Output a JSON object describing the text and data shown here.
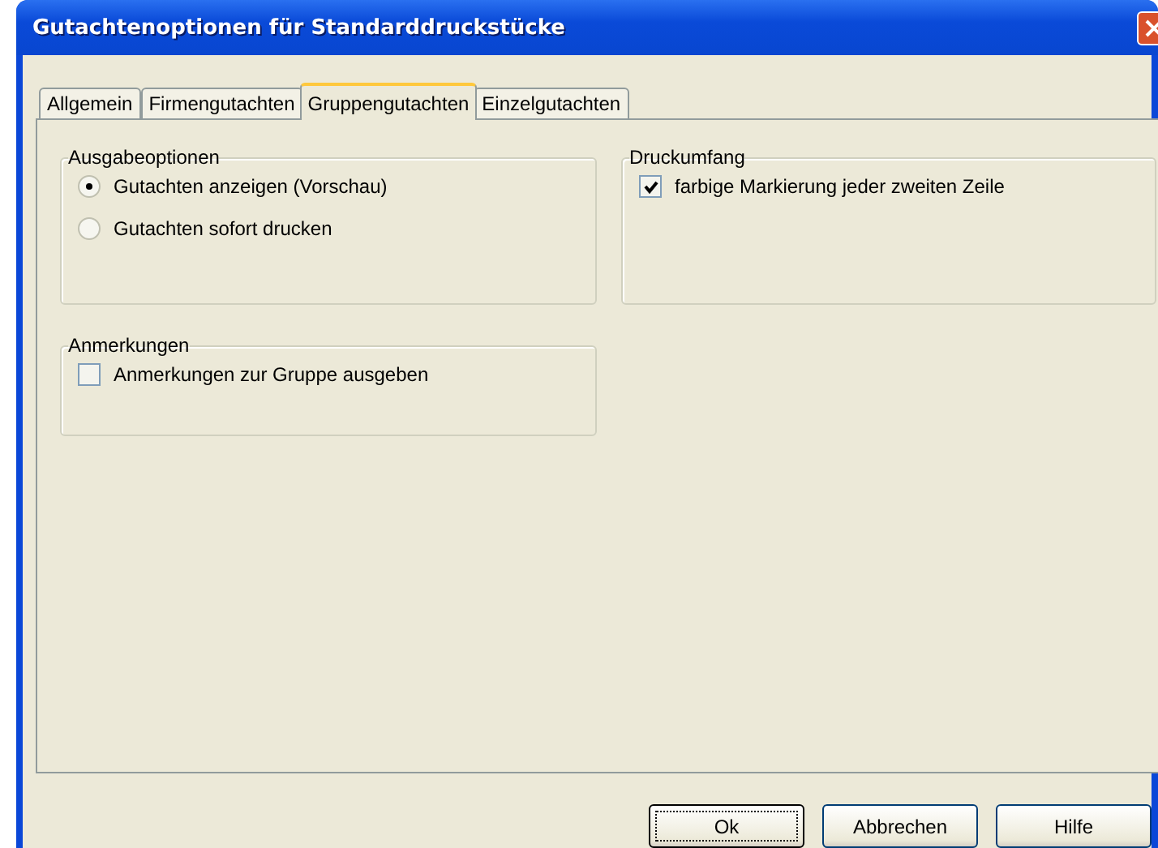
{
  "window": {
    "title": "Gutachtenoptionen für Standarddruckstücke"
  },
  "tabs": [
    {
      "label": "Allgemein",
      "selected": false
    },
    {
      "label": "Firmengutachten",
      "selected": false
    },
    {
      "label": "Gruppengutachten",
      "selected": true
    },
    {
      "label": "Einzelgutachten",
      "selected": false
    }
  ],
  "ausgabeoptionen": {
    "title": "Ausgabeoptionen",
    "options": [
      {
        "label": "Gutachten anzeigen (Vorschau)",
        "selected": true
      },
      {
        "label": "Gutachten sofort drucken",
        "selected": false
      }
    ]
  },
  "anmerkungen": {
    "title": "Anmerkungen",
    "checkbox": {
      "label": "Anmerkungen zur Gruppe ausgeben",
      "checked": false
    }
  },
  "druckumfang": {
    "title": "Druckumfang",
    "checkbox": {
      "label": "farbige Markierung jeder zweiten Zeile",
      "checked": true
    }
  },
  "buttons": [
    {
      "label": "Ok",
      "default": true
    },
    {
      "label": "Abbrechen",
      "default": false
    },
    {
      "label": "Hilfe",
      "default": false
    }
  ]
}
